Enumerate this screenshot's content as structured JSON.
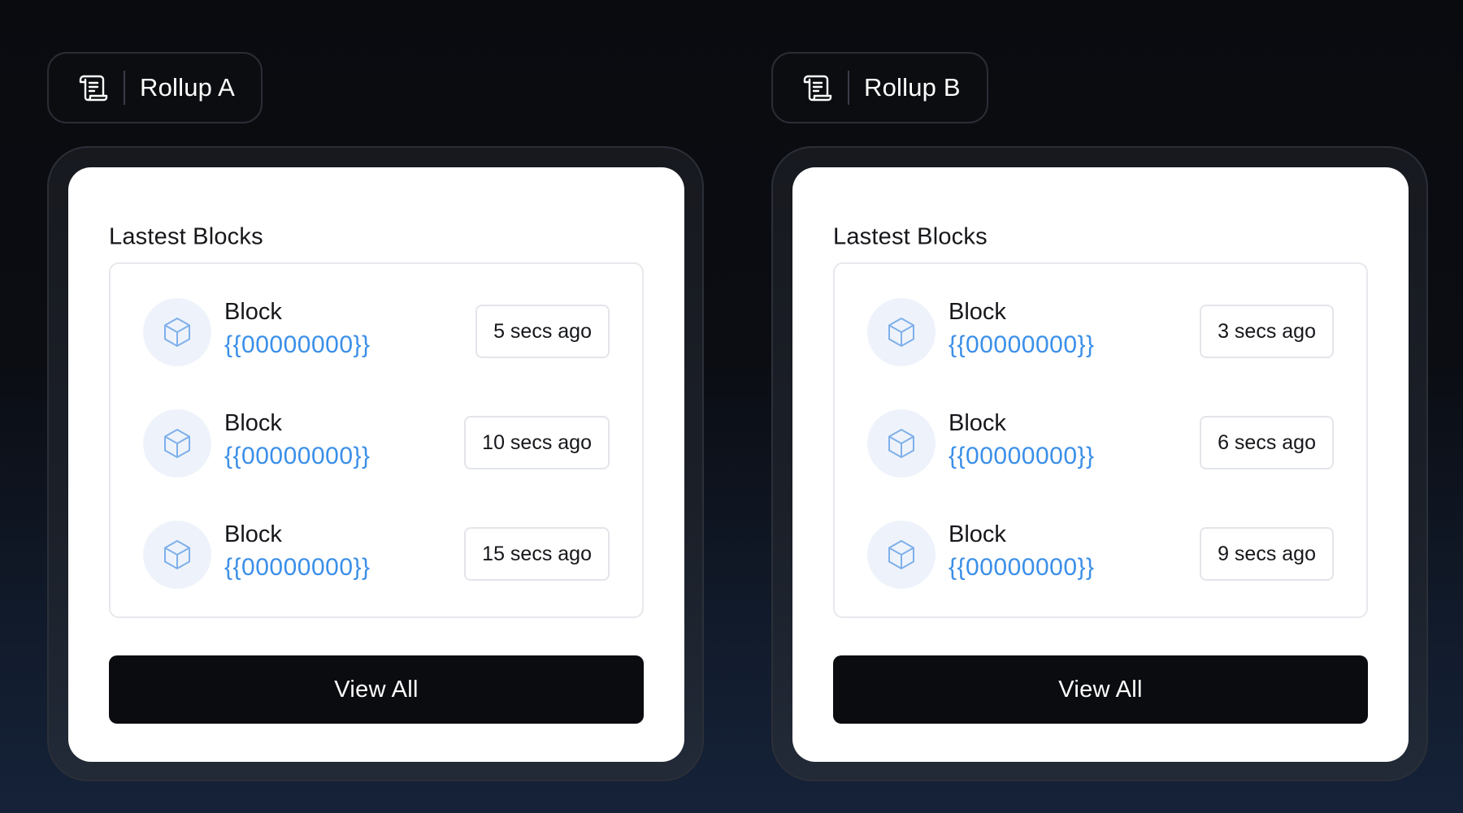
{
  "panels": [
    {
      "rollup_name": "Rollup A",
      "card_title": "Lastest Blocks",
      "blocks": [
        {
          "label": "Block",
          "hash": "{{00000000}}",
          "time": "5 secs ago"
        },
        {
          "label": "Block",
          "hash": "{{00000000}}",
          "time": "10 secs ago"
        },
        {
          "label": "Block",
          "hash": "{{00000000}}",
          "time": "15 secs ago"
        }
      ],
      "view_all_label": "View All"
    },
    {
      "rollup_name": "Rollup B",
      "card_title": "Lastest Blocks",
      "blocks": [
        {
          "label": "Block",
          "hash": "{{00000000}}",
          "time": "3 secs ago"
        },
        {
          "label": "Block",
          "hash": "{{00000000}}",
          "time": "6 secs ago"
        },
        {
          "label": "Block",
          "hash": "{{00000000}}",
          "time": "9 secs ago"
        }
      ],
      "view_all_label": "View All"
    }
  ],
  "icons": {
    "rollup_chip": "scroll-icon",
    "block": "cube-icon"
  },
  "colors": {
    "background": "#0a0b0f",
    "card": "#ffffff",
    "hash_link": "#3b8fe8",
    "button": "#0b0c10",
    "icon_bg": "#eef3fb",
    "icon_stroke": "#7fb0ea"
  }
}
